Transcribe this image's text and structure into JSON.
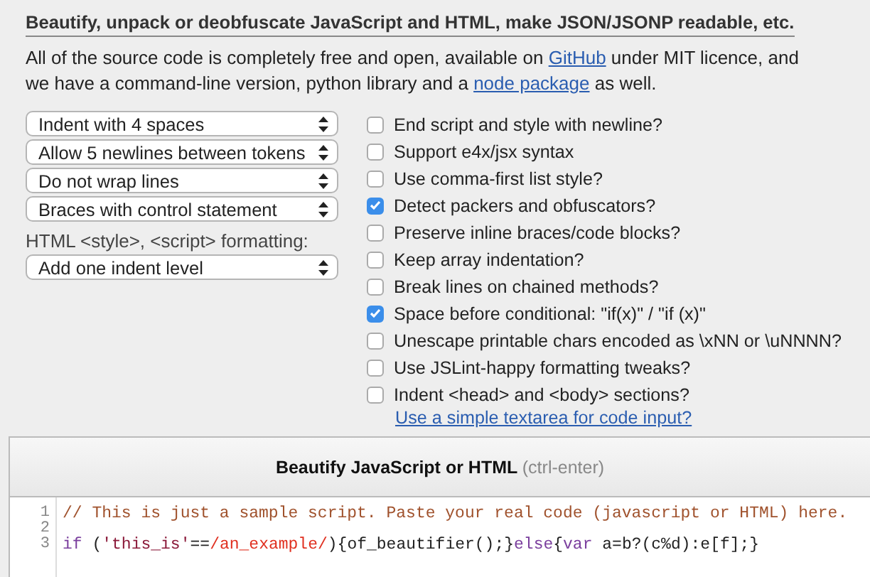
{
  "heading": "Beautify, unpack or deobfuscate JavaScript and HTML, make JSON/JSONP readable, etc.",
  "intro": [
    {
      "kind": "text",
      "text": "All of the source code is completely free and open, available on "
    },
    {
      "kind": "link",
      "text": "GitHub"
    },
    {
      "kind": "text",
      "text": " under MIT licence, and we have a command-line version, python library and a "
    },
    {
      "kind": "link",
      "text": "node package"
    },
    {
      "kind": "text",
      "text": " as well."
    }
  ],
  "selects": [
    {
      "value": "Indent with 4 spaces"
    },
    {
      "value": "Allow 5 newlines between tokens"
    },
    {
      "value": "Do not wrap lines"
    },
    {
      "value": "Braces with control statement"
    }
  ],
  "html_formatting": {
    "label": "HTML <style>, <script> formatting:",
    "value": "Add one indent level"
  },
  "options": [
    {
      "label": "End script and style with newline?",
      "checked": false
    },
    {
      "label": "Support e4x/jsx syntax",
      "checked": false
    },
    {
      "label": "Use comma-first list style?",
      "checked": false
    },
    {
      "label": "Detect packers and obfuscators?",
      "checked": true
    },
    {
      "label": "Preserve inline braces/code blocks?",
      "checked": false
    },
    {
      "label": "Keep array indentation?",
      "checked": false
    },
    {
      "label": "Break lines on chained methods?",
      "checked": false
    },
    {
      "label": "Space before conditional: \"if(x)\" / \"if (x)\"",
      "checked": true
    },
    {
      "label": "Unescape printable chars encoded as \\xNN or \\uNNNN?",
      "checked": false
    },
    {
      "label": "Use JSLint-happy formatting tweaks?",
      "checked": false
    },
    {
      "label": "Indent <head> and <body> sections?",
      "checked": false
    }
  ],
  "textarea_link": "Use a simple textarea for code input?",
  "beautify_button": {
    "label": "Beautify JavaScript or HTML",
    "shortcut": "(ctrl-enter)"
  },
  "editor": {
    "lines": [
      {
        "number": "1",
        "tokens": [
          {
            "kind": "comment",
            "text": "// This is just a sample script. Paste your real code (javascript or HTML) here."
          }
        ]
      },
      {
        "number": "2"
      },
      {
        "number": "3",
        "tokens": [
          {
            "kind": "keyword",
            "text": "if"
          },
          {
            "kind": "plain",
            "text": " ("
          },
          {
            "kind": "string",
            "text": "'this_is'"
          },
          {
            "kind": "plain",
            "text": "=="
          },
          {
            "kind": "regex",
            "text": "/an_example/"
          },
          {
            "kind": "plain",
            "text": "){of_beautifier();}"
          },
          {
            "kind": "keyword",
            "text": "else"
          },
          {
            "kind": "plain",
            "text": "{"
          },
          {
            "kind": "keyword",
            "text": "var"
          },
          {
            "kind": "plain",
            "text": " a=b?(c%d):e[f];}"
          }
        ]
      }
    ]
  }
}
